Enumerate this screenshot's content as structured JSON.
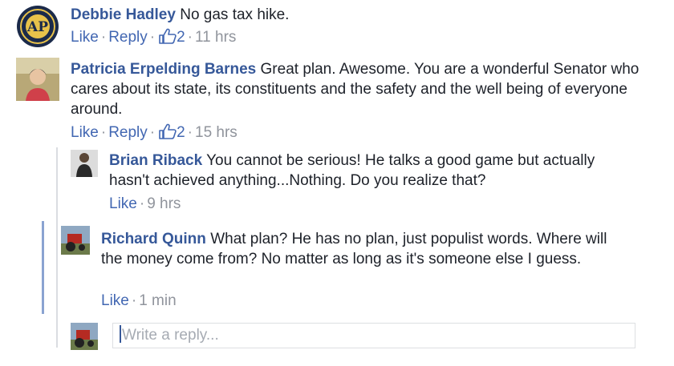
{
  "comments": [
    {
      "author": "Debbie Hadley",
      "text": "No gas tax hike.",
      "like_label": "Like",
      "reply_label": "Reply",
      "likes": "2",
      "time": "11 hrs",
      "avatar_icon": "ap-logo-icon"
    },
    {
      "author": "Patricia Erpelding Barnes",
      "text": "Great plan. Awesome. You are a wonderful Senator who cares about its state, its constituents and the safety and the well being of everyone around.",
      "like_label": "Like",
      "reply_label": "Reply",
      "likes": "2",
      "time": "15 hrs"
    }
  ],
  "replies": [
    {
      "author": "Brian Riback",
      "text": "You cannot be serious! He talks a good game but actually hasn't achieved anything...Nothing. Do you realize that?",
      "like_label": "Like",
      "time": "9 hrs"
    },
    {
      "author": "Richard Quinn",
      "text": "What plan? He has no plan, just populist words. Where will the money come from? No matter as long as it's someone else I guess.",
      "like_label": "Like",
      "time": "1 min"
    }
  ],
  "reply_box": {
    "placeholder": "Write a reply..."
  },
  "colors": {
    "name": "#365899",
    "link": "#4267b2",
    "meta": "#90949c",
    "thread_active": "#8aa3d1"
  }
}
